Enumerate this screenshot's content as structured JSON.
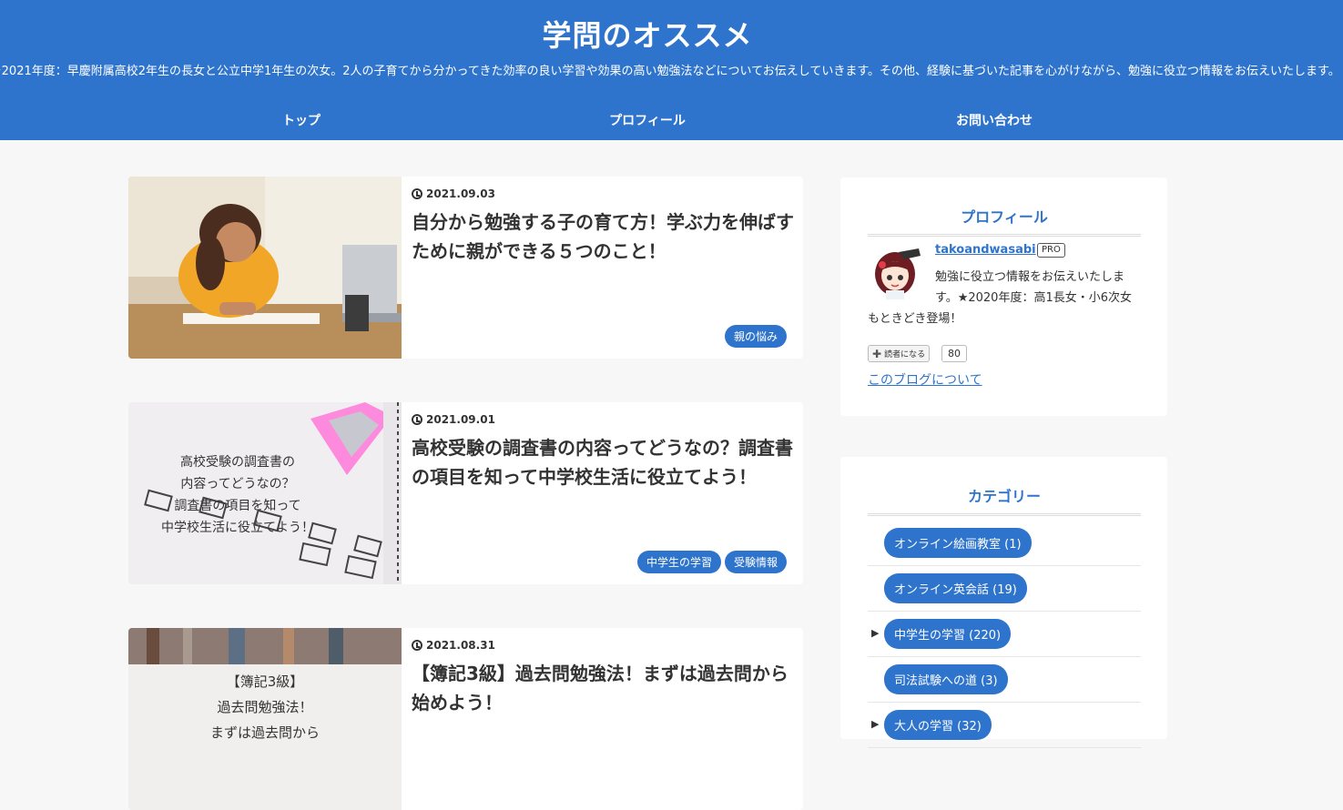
{
  "header": {
    "title": "学問のオススメ",
    "description": "★2021年度：早慶附属高校2年生の長女と公立中学1年生の次女。2人の子育てから分かってきた効率の良い学習や効果の高い勉強法などについてお伝えしていきます。その他、経験に基づいた記事を心がけながら、勉強に役立つ情報をお伝えいたします。",
    "nav": [
      "トップ",
      "プロフィール",
      "お問い合わせ"
    ]
  },
  "articles": [
    {
      "date": "2021.09.03",
      "title": "自分から勉強する子の育て方！学ぶ力を伸ばすために親ができる５つのこと！",
      "tags": [
        "親の悩み"
      ]
    },
    {
      "date": "2021.09.01",
      "title": "高校受験の調査書の内容ってどうなの？調査書の項目を知って中学校生活に役立てよう！",
      "tags": [
        "中学生の学習",
        "受験情報"
      ],
      "thumb_text": [
        "高校受験の調査書の",
        "内容ってどうなの？",
        "調査書の項目を知って",
        "中学校生活に役立てよう！"
      ]
    },
    {
      "date": "2021.08.31",
      "title": "【簿記3級】過去問勉強法！まずは過去問から始めよう！",
      "tags": [],
      "thumb_text": [
        "【簿記3級】",
        "過去問勉強法！",
        "まずは過去問から"
      ]
    }
  ],
  "sidebar": {
    "profile": {
      "heading": "プロフィール",
      "author": "takoandwasabi",
      "badge": "PRO",
      "description": "勉強に役立つ情報をお伝えいたします。★2020年度：高1長女・小6次女もときどき登場！",
      "reader_button": "読者になる",
      "reader_count": "80",
      "about_link": "このブログについて"
    },
    "categories": {
      "heading": "カテゴリー",
      "items": [
        {
          "label": "オンライン絵画教室 (1)",
          "expandable": false
        },
        {
          "label": "オンライン英会話 (19)",
          "expandable": false
        },
        {
          "label": "中学生の学習 (220)",
          "expandable": true
        },
        {
          "label": "司法試験への道 (3)",
          "expandable": false
        },
        {
          "label": "大人の学習 (32)",
          "expandable": true
        }
      ]
    }
  },
  "colors": {
    "primary": "#2f74cc",
    "background": "#f7f7f8",
    "card": "#ffffff"
  }
}
